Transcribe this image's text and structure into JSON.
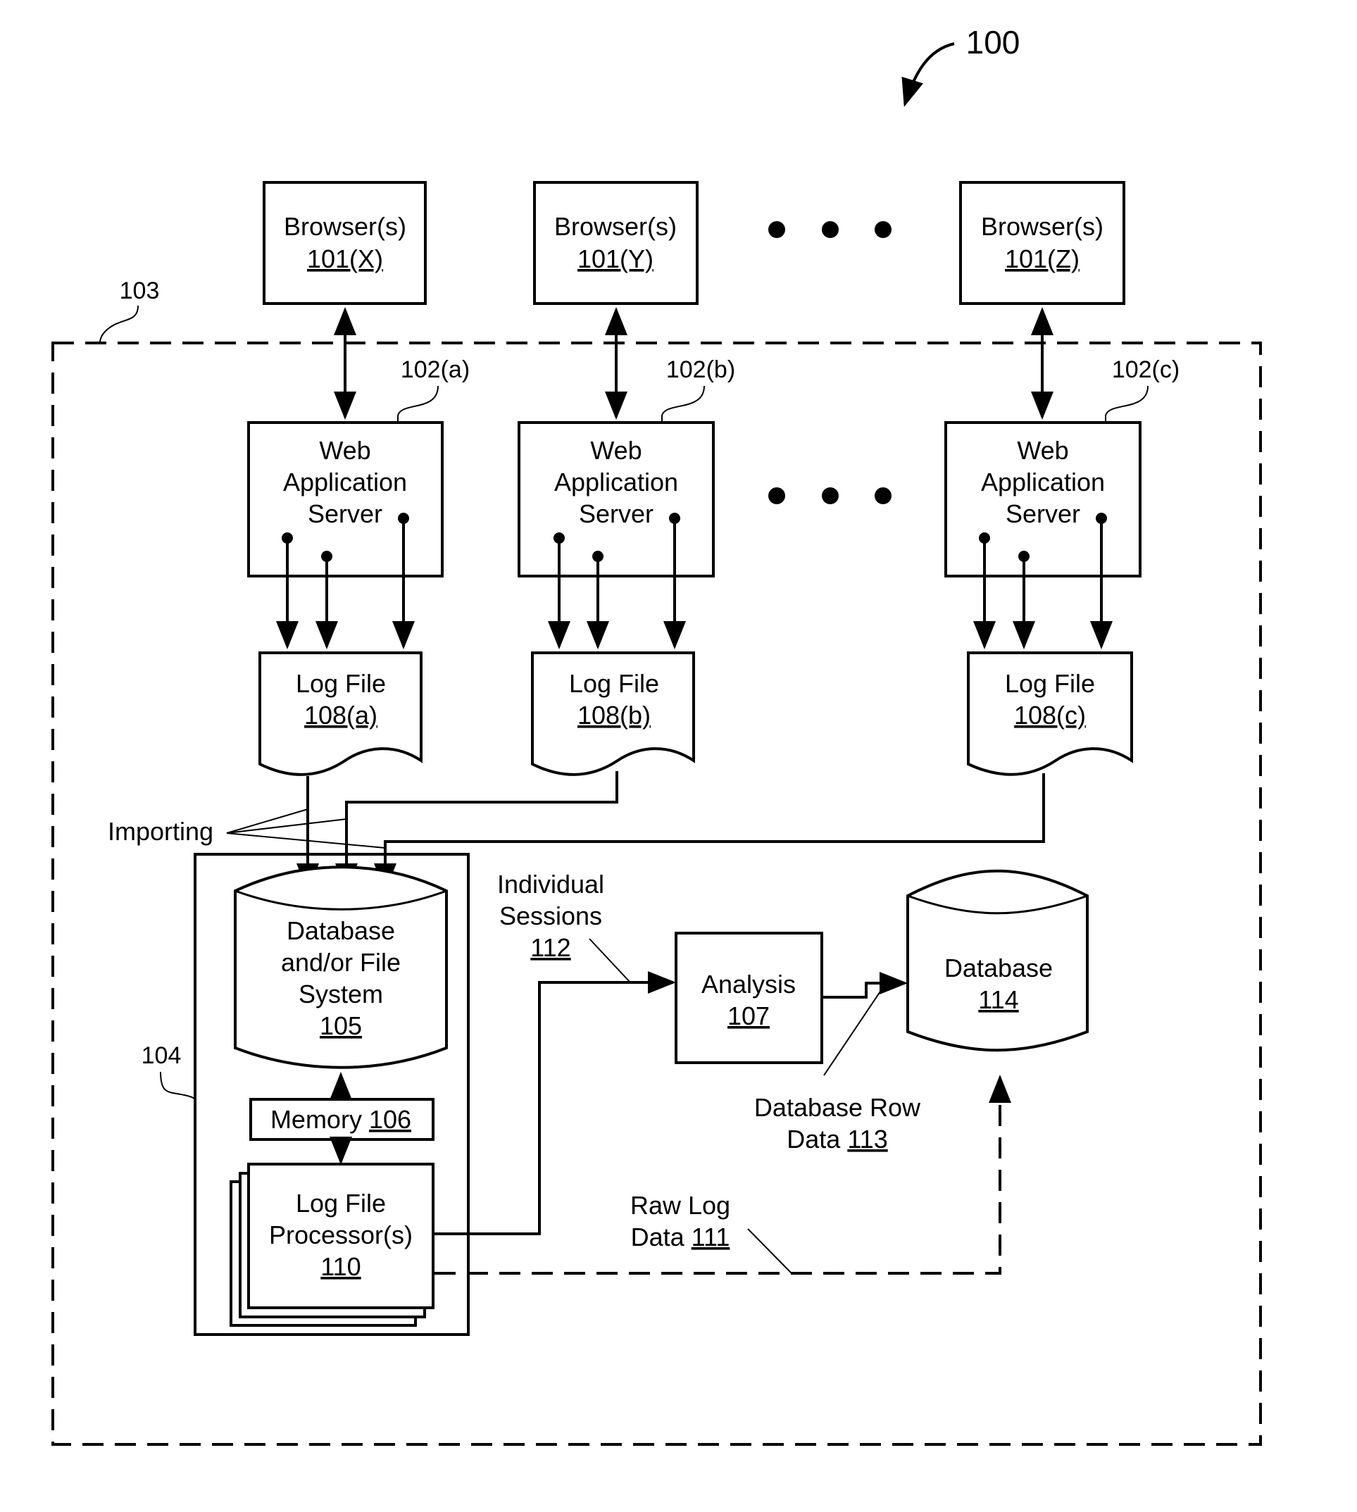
{
  "figure": {
    "ref": "100",
    "system_ref": "103",
    "server_group_ref": "104",
    "ellipsis": "• • •"
  },
  "browsers": [
    {
      "label": "Browser(s)",
      "ref": "101(X)"
    },
    {
      "label": "Browser(s)",
      "ref": "101(Y)"
    },
    {
      "label": "Browser(s)",
      "ref": "101(Z)"
    }
  ],
  "servers": [
    {
      "lines": [
        "Web",
        "Application",
        "Server"
      ],
      "ref": "102(a)"
    },
    {
      "lines": [
        "Web",
        "Application",
        "Server"
      ],
      "ref": "102(b)"
    },
    {
      "lines": [
        "Web",
        "Application",
        "Server"
      ],
      "ref": "102(c)"
    }
  ],
  "logfiles": [
    {
      "label": "Log File",
      "ref": "108(a)"
    },
    {
      "label": "Log File",
      "ref": "108(b)"
    },
    {
      "label": "Log File",
      "ref": "108(c)"
    }
  ],
  "importing": "Importing",
  "storage": {
    "lines": [
      "Database",
      "and/or File",
      "System"
    ],
    "ref": "105"
  },
  "memory": {
    "label": "Memory",
    "ref": "106"
  },
  "processor": {
    "lines": [
      "Log File",
      "Processor(s)"
    ],
    "ref": "110"
  },
  "sessions": {
    "lines": [
      "Individual",
      "Sessions"
    ],
    "ref": "112"
  },
  "analysis": {
    "label": "Analysis",
    "ref": "107"
  },
  "database": {
    "label": "Database",
    "ref": "114"
  },
  "row_data": {
    "line1": "Database Row",
    "line2": "Data",
    "ref": "113"
  },
  "raw_log": {
    "line1": "Raw Log",
    "line2": "Data",
    "ref": "111"
  }
}
